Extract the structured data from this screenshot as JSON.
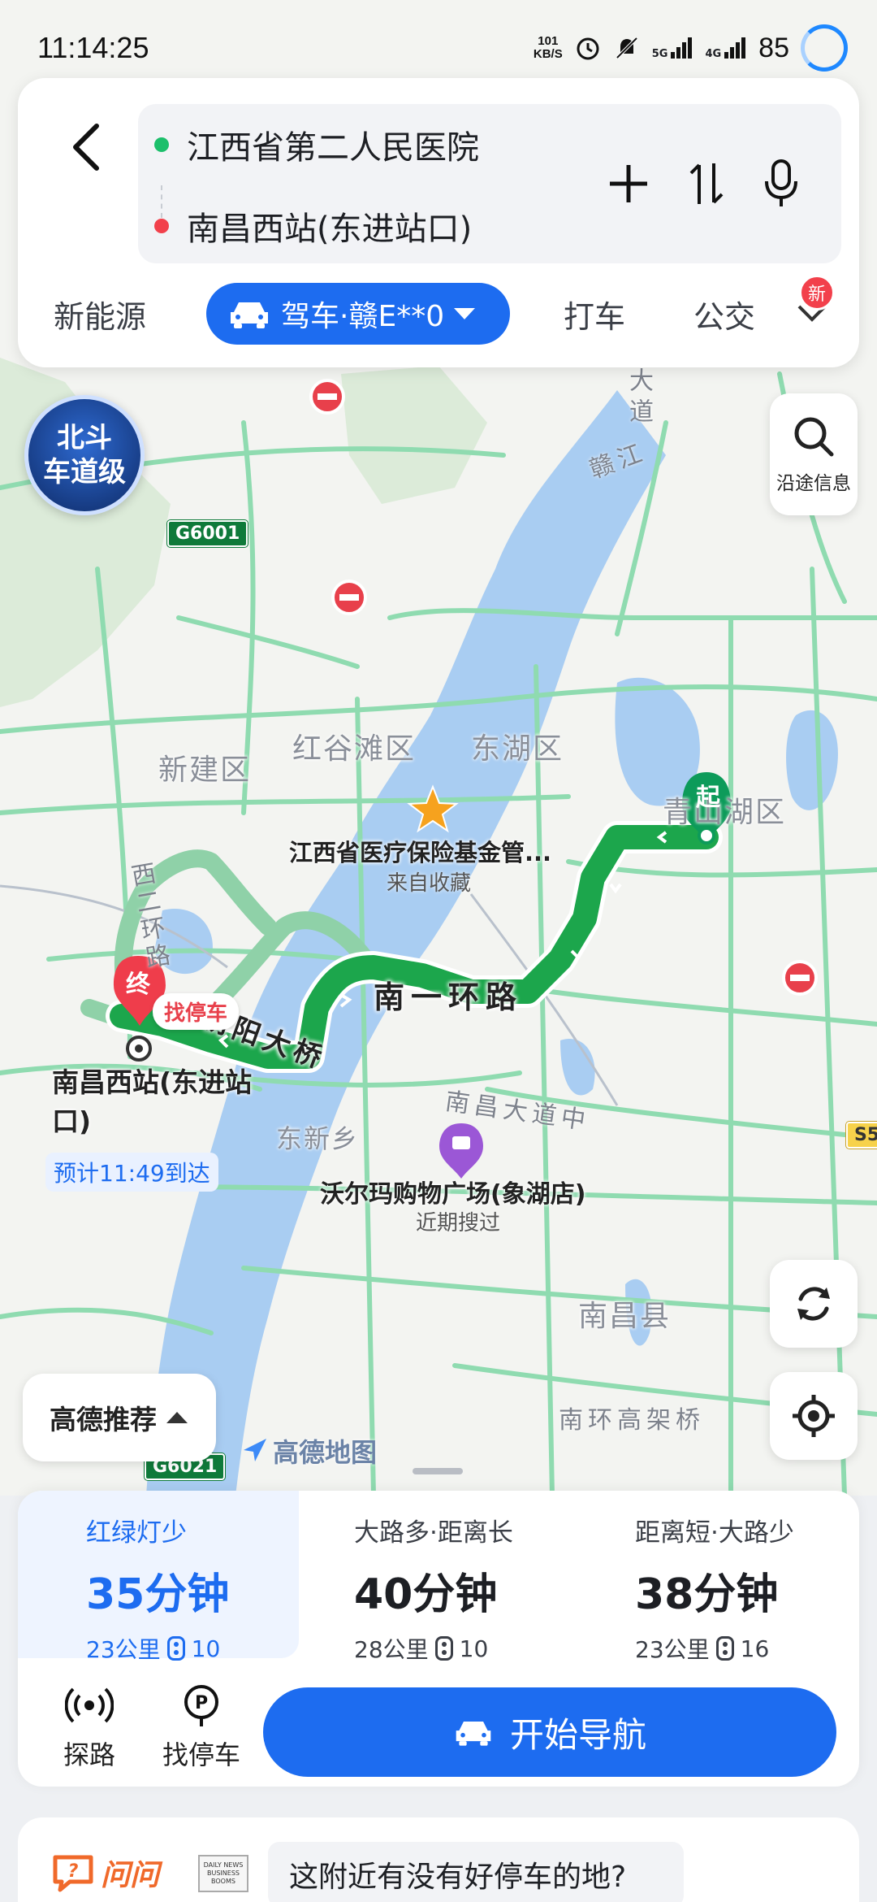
{
  "status_bar": {
    "time": "11:14:25",
    "net_speed_value": "101",
    "net_speed_unit": "KB/S",
    "network_1": "5G",
    "network_2": "4G",
    "battery": "85"
  },
  "route_card": {
    "origin": "江西省第二人民医院",
    "destination": "南昌西站(东进站口)",
    "origin_dot_color": "#1cbf6b",
    "destination_dot_color": "#f2404b",
    "modes": {
      "new_energy": "新能源",
      "drive": "驾车·赣E**0",
      "taxi": "打车",
      "bus": "公交"
    },
    "new_badge": "新"
  },
  "map": {
    "beidou_line1": "北斗",
    "beidou_line2": "车道级",
    "along_route": "沿途信息",
    "districts": {
      "xinjian": "新建区",
      "honggutan": "红谷滩区",
      "donghu": "东湖区",
      "qingshanhu": "青山湖区",
      "nanchang_county": "南昌县",
      "dongxin": "东新乡"
    },
    "roads": {
      "nanyihuan": "南一环路",
      "bridge": "朝阳大桥",
      "xierhuan": "西二环路",
      "nanchang_avenue": "南昌大道中",
      "ganjiang": "赣江",
      "south_elevated": "南环高架桥",
      "avenue_north": "大道"
    },
    "shields": {
      "g6001": "G6001",
      "g6021": "G6021",
      "s5": "S5"
    },
    "start_marker": "起",
    "end_marker": "终",
    "find_parking_tag": "找停车",
    "destination_label": "南昌西站(东进站口)",
    "eta": "预计11:49到达",
    "favorite_poi": "江西省医疗保险基金管...",
    "favorite_sub": "来自收藏",
    "walmart": "沃尔玛购物广场(象湖店)",
    "walmart_sub": "近期搜过",
    "recommend": "高德推荐",
    "logo": "高德地图",
    "route_color": "#1ca64c",
    "alt_route_color": "#8fd1a8"
  },
  "routes": [
    {
      "tag": "红绿灯少",
      "time": "35分钟",
      "distance": "23公里",
      "lights": "10"
    },
    {
      "tag": "大路多·距离长",
      "time": "40分钟",
      "distance": "28公里",
      "lights": "10"
    },
    {
      "tag": "距离短·大路少",
      "time": "38分钟",
      "distance": "23公里",
      "lights": "16"
    }
  ],
  "tools": {
    "explore": "探路",
    "parking": "找停车",
    "start": "开始导航"
  },
  "ask": {
    "logo": "问问",
    "thumb_text": "DAILY NEWS BUSINESS BOOMS",
    "question": "这附近有没有好停车的地?"
  }
}
